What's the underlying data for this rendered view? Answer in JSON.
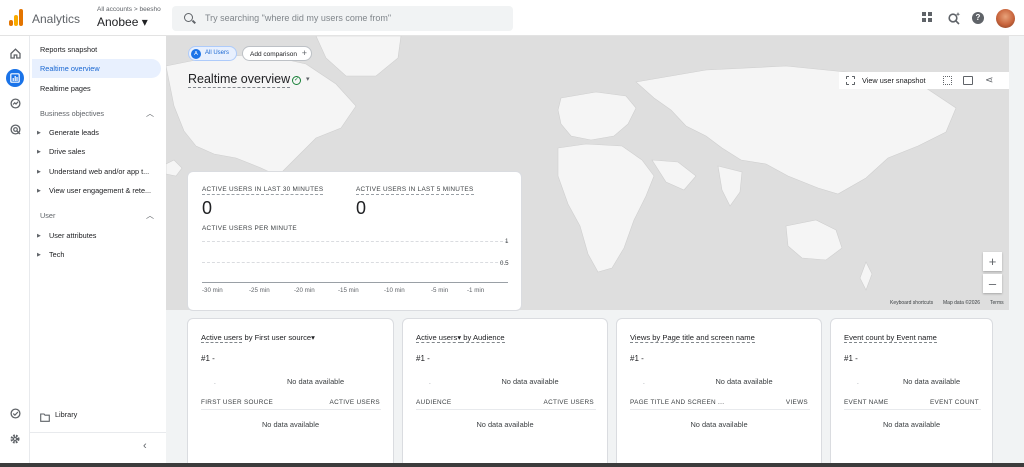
{
  "header": {
    "app_name": "Analytics",
    "account_crumb": "All accounts > beesho",
    "account_name": "Anobee ▾",
    "search_placeholder": "Try searching \"where did my users come from\""
  },
  "sidebar": {
    "items": [
      "Reports snapshot",
      "Realtime overview",
      "Realtime pages"
    ],
    "sections": [
      {
        "label": "Business objectives",
        "items": [
          "Generate leads",
          "Drive sales",
          "Understand web and/or app t...",
          "View user engagement & rete..."
        ]
      },
      {
        "label": "User",
        "items": [
          "User attributes",
          "Tech"
        ]
      }
    ],
    "library_label": "Library"
  },
  "comparison": {
    "all_users_badge": "A",
    "all_users_label": "All Users",
    "add_comparison_label": "Add comparison"
  },
  "page": {
    "title": "Realtime overview",
    "view_snapshot_label": "View user snapshot"
  },
  "map": {
    "keyboard_shortcuts": "Keyboard shortcuts",
    "map_data": "Map data ©2026",
    "terms": "Terms",
    "zoom_in": "+",
    "zoom_out": "–",
    "land_color": "#f5f5f5",
    "water_color": "#dedede"
  },
  "overview_card": {
    "kpi_30_label": "ACTIVE USERS IN LAST 30 MINUTES",
    "kpi_30_value": "0",
    "kpi_5_label": "ACTIVE USERS IN LAST 5 MINUTES",
    "kpi_5_value": "0",
    "per_minute_label": "ACTIVE USERS PER MINUTE",
    "y_ticks": [
      "1",
      "0.5"
    ],
    "x_ticks": [
      "-30 min",
      "-25 min",
      "-20 min",
      "-15 min",
      "-10 min",
      "-5 min",
      "-1 min"
    ]
  },
  "cards": [
    {
      "title_main": "Active users",
      "title_rest": " by First user source▾",
      "rank": "#1  -",
      "dash": "-",
      "no_data": "No data available",
      "col_left": "FIRST USER SOURCE",
      "col_right": "ACTIVE USERS",
      "no_data_2": "No data available"
    },
    {
      "title_main": "Active users▾",
      "title_rest": " by Audience",
      "rank": "#1  -",
      "dash": "-",
      "no_data": "No data available",
      "col_left": "AUDIENCE",
      "col_right": "ACTIVE USERS",
      "no_data_2": "No data available"
    },
    {
      "title_main": "Views by Page title and screen name",
      "title_rest": "",
      "rank": "#1  -",
      "dash": "-",
      "no_data": "No data available",
      "col_left": "PAGE TITLE AND SCREEN ...",
      "col_right": "VIEWS",
      "no_data_2": "No data available"
    },
    {
      "title_main": "Event count by Event name",
      "title_rest": "",
      "rank": "#1  -",
      "dash": "-",
      "no_data": "No data available",
      "col_left": "EVENT NAME",
      "col_right": "EVENT COUNT",
      "no_data_2": "No data available"
    }
  ],
  "colors": {
    "accent": "#1a73e8",
    "success": "#188038"
  }
}
